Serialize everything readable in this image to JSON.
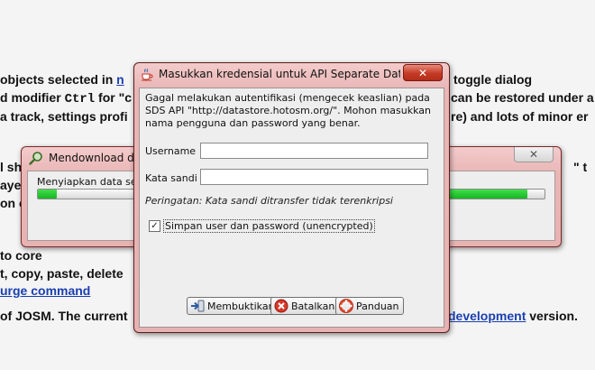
{
  "background": {
    "lines": [
      {
        "pre": "objects selected in ",
        "link": "n",
        "post": "",
        "tail_link": "",
        "tail": " toggle dialog"
      },
      {
        "pre": "d modifier ",
        "code": "Ctrl",
        "post": " for \"c",
        "tail": "can be restored under a"
      },
      {
        "pre": "a track, settings profi",
        "tail": "re) and lots of minor er"
      },
      {
        "pre": "l sh",
        "tail": "\" t"
      },
      {
        "pre": "aye"
      },
      {
        "pre": "on c"
      },
      {
        "pre": "to core"
      },
      {
        "pre": "t, copy, paste, delete"
      },
      {
        "link": "urge command"
      },
      {
        "pre": "of JOSM. The current ",
        "tail_link": "development",
        "tail": " version."
      }
    ]
  },
  "progress_window": {
    "title": "Mendownload dat",
    "label": "Menyiapkan data set...",
    "progress_top_fraction": 0.2,
    "progress_bottom_fraction": 0.92,
    "close_icon": "close-icon"
  },
  "dialog": {
    "title": "Masukkan kredensial untuk API Separate Data S...",
    "message": "Gagal melakukan autentifikasi (mengecek keaslian) pada SDS API \"http://datastore.hotosm.org/\". Mohon masukkan nama pengguna dan password yang benar.",
    "username_label": "Username",
    "username_value": "",
    "password_label": "Kata sandi",
    "password_value": "",
    "warning": "Peringatan: Kata sandi ditransfer tidak terenkripsi",
    "save_checkbox_label": "Simpan user dan password (unencrypted)",
    "save_checked": true,
    "buttons": {
      "ok": "Membuktikan",
      "cancel": "Batalkan",
      "help": "Panduan"
    }
  },
  "colors": {
    "title_bar": "#e9b5b5",
    "close_button": "#c43b25",
    "progress_fill": "#17b524",
    "link": "#1a3fb0"
  }
}
